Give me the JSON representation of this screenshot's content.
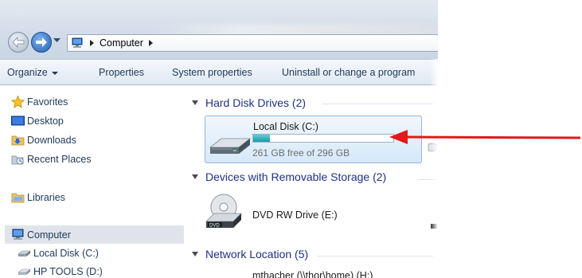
{
  "address": {
    "crumbs": [
      "Computer"
    ]
  },
  "toolbar": {
    "organize": "Organize",
    "properties": "Properties",
    "system_properties": "System properties",
    "uninstall": "Uninstall or change a program"
  },
  "nav_pane": {
    "favorites": "Favorites",
    "desktop": "Desktop",
    "downloads": "Downloads",
    "recent": "Recent Places",
    "libraries": "Libraries",
    "computer": "Computer",
    "local_disk": "Local Disk (C:)",
    "hp_tools": "HP TOOLS (D:)"
  },
  "content": {
    "hdd_header": "Hard Disk Drives (2)",
    "removable_header": "Devices with Removable Storage (2)",
    "network_header": "Network Location (5)",
    "drive_c": {
      "name": "Local Disk (C:)",
      "free_text": "261 GB free of 296 GB",
      "used_fraction": 0.12
    },
    "dvd": {
      "name": "DVD RW Drive (E:)"
    },
    "network_item": "mthacher (\\\\thor\\home) (H:)"
  },
  "annotation": {
    "arrow_color": "#e3191b"
  },
  "icons": {
    "nav_back": "back-arrow-icon",
    "nav_forward": "forward-arrow-icon",
    "favorites": "star-icon",
    "desktop": "desktop-icon",
    "downloads": "downloads-folder-icon",
    "recent": "recent-places-icon",
    "libraries": "libraries-icon",
    "computer": "computer-icon",
    "hard_drive": "hard-drive-icon",
    "dvd": "dvd-drive-icon"
  }
}
